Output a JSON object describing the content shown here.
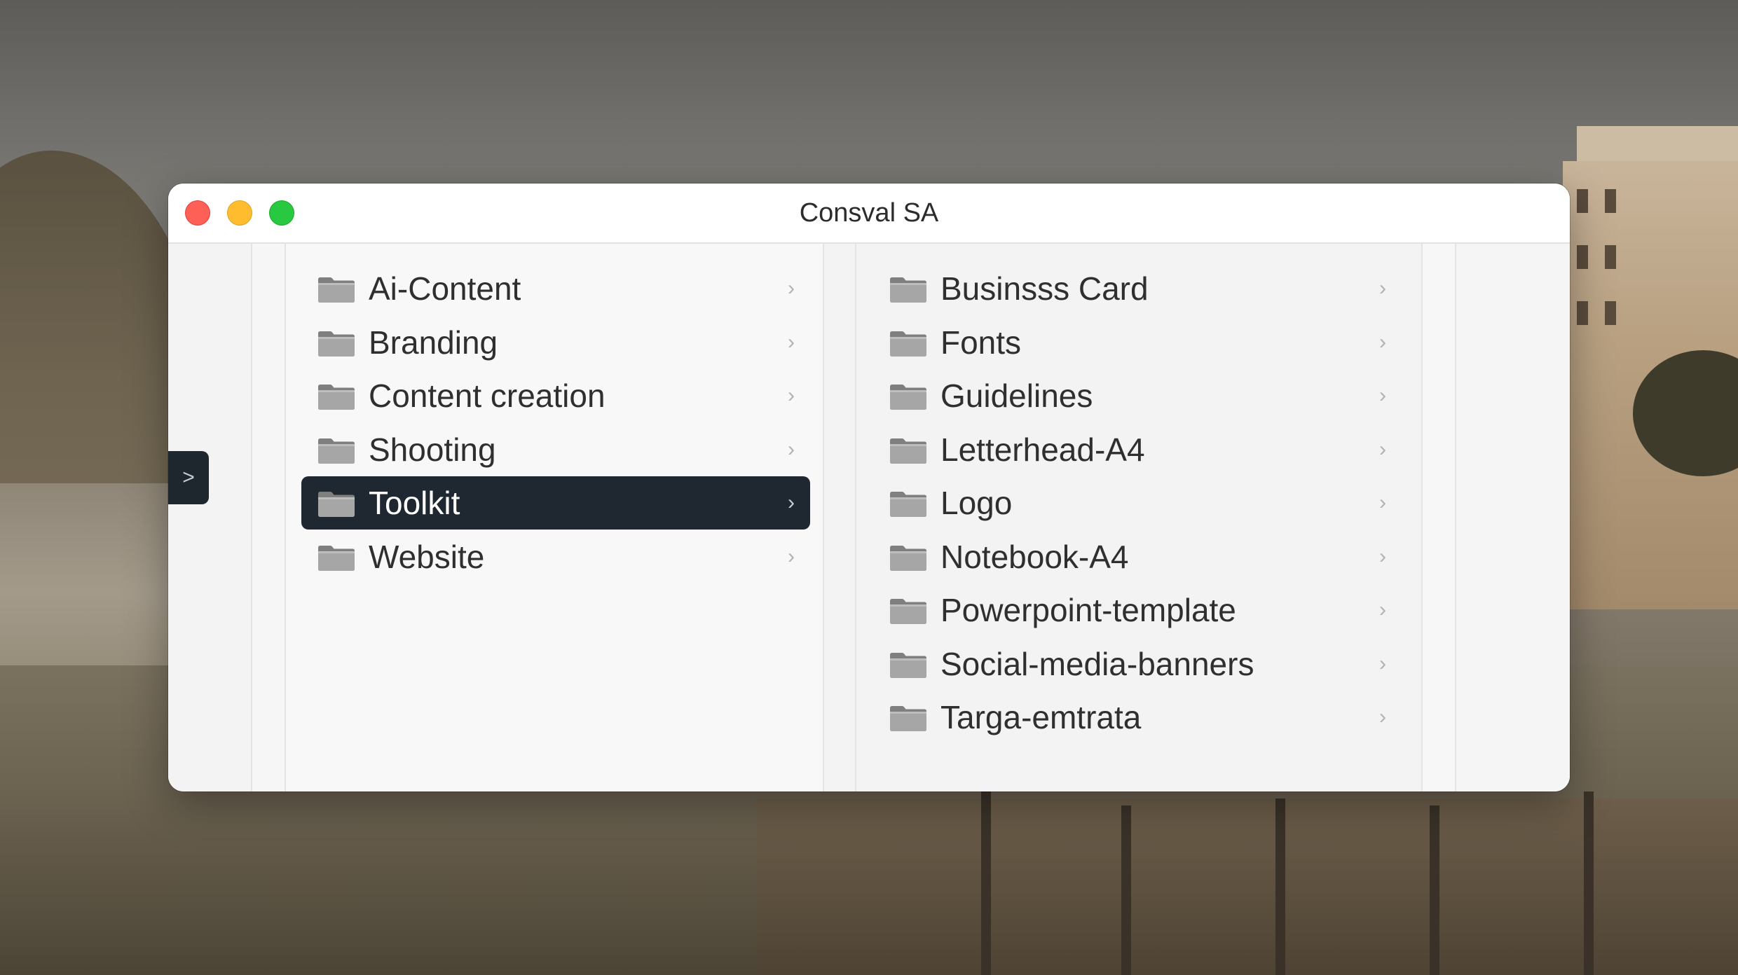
{
  "window": {
    "title": "Consval SA"
  },
  "sidebar_toggle": {
    "icon": "chevron-right-icon",
    "glyph": ">"
  },
  "columns": [
    {
      "items": [
        {
          "label": "Ai-Content",
          "selected": false
        },
        {
          "label": "Branding",
          "selected": false
        },
        {
          "label": "Content creation",
          "selected": false
        },
        {
          "label": "Shooting",
          "selected": false
        },
        {
          "label": "Toolkit",
          "selected": true
        },
        {
          "label": "Website",
          "selected": false
        }
      ]
    },
    {
      "items": [
        {
          "label": "Businsss Card",
          "selected": false
        },
        {
          "label": "Fonts",
          "selected": false
        },
        {
          "label": "Guidelines",
          "selected": false
        },
        {
          "label": "Letterhead-A4",
          "selected": false
        },
        {
          "label": "Logo",
          "selected": false
        },
        {
          "label": "Notebook-A4",
          "selected": false
        },
        {
          "label": "Powerpoint-template",
          "selected": false
        },
        {
          "label": "Social-media-banners",
          "selected": false
        },
        {
          "label": "Targa-emtrata",
          "selected": false
        }
      ]
    }
  ],
  "colors": {
    "selection": "#1f2831",
    "traffic_close": "#fe5f57",
    "traffic_minimize": "#febc2e",
    "traffic_maximize": "#28c840"
  },
  "icons": {
    "folder": "folder-icon",
    "chevron": "chevron-right-icon"
  }
}
